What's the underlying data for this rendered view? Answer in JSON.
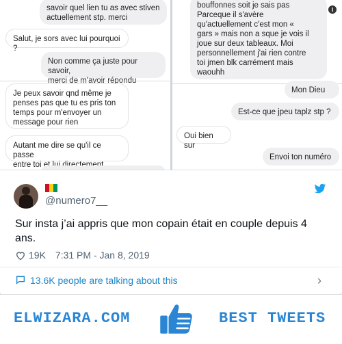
{
  "left_panel": {
    "messages": [
      {
        "text_lines": [
          "savoir quel lien tu as avec stiven",
          "actuellement stp. merci"
        ],
        "style": "gray"
      },
      {
        "text_lines": [
          "Salut, je sors avec lui pourquoi ?"
        ],
        "style": "white"
      },
      {
        "text_lines": [
          "Non comme ça juste pour savoir,",
          "merci de m'avoir répondu"
        ],
        "style": "gray"
      },
      {
        "text_lines": [
          "Je peux savoir qnd même je",
          "penses pas que tu es pris ton",
          "temps pour m'envoyer un",
          "message pour rien"
        ],
        "style": "white"
      },
      {
        "text_lines": [
          "Autant me dire se qu'il ce passe",
          "entre toi et lui directement"
        ],
        "style": "white"
      }
    ]
  },
  "right_panel": {
    "messages": [
      {
        "text_lines": [
          "bouffonnes soit je sais pas",
          "Parceque il s'avère",
          "qu'actuellement c'est mon «",
          "gars » mais non a sque je vois il",
          "joue sur deux tableaux. Moi",
          "personnellement j'ai rien contre",
          "toi jmen blk carrément mais",
          "waouhh"
        ],
        "style": "gray"
      },
      {
        "text_lines": [
          "Mon Dieu"
        ],
        "style": "gray"
      },
      {
        "text_lines": [
          "Est-ce que jpeu taplz stp ?"
        ],
        "style": "gray"
      },
      {
        "text_lines": [
          "Oui bien sur"
        ],
        "style": "white"
      },
      {
        "text_lines": [
          "Envoi ton numéro"
        ],
        "style": "gray"
      }
    ],
    "info_icon": "info-icon"
  },
  "tweet": {
    "handle": "@numero7__",
    "flag_colors": [
      "#ce1126",
      "#fcd116",
      "#009460"
    ],
    "text": "Sur insta j’ai appris que mon copain était en couple depuis 4 ans.",
    "likes": "19K",
    "timestamp": "7:31 PM - Jan 8, 2019",
    "talking": "13.6K people are talking about this",
    "accent": "#1da1f2"
  },
  "footer": {
    "brand": "ELWIZARA.COM",
    "tagline": "BEST TWEETS",
    "color": "#2a86d4"
  }
}
